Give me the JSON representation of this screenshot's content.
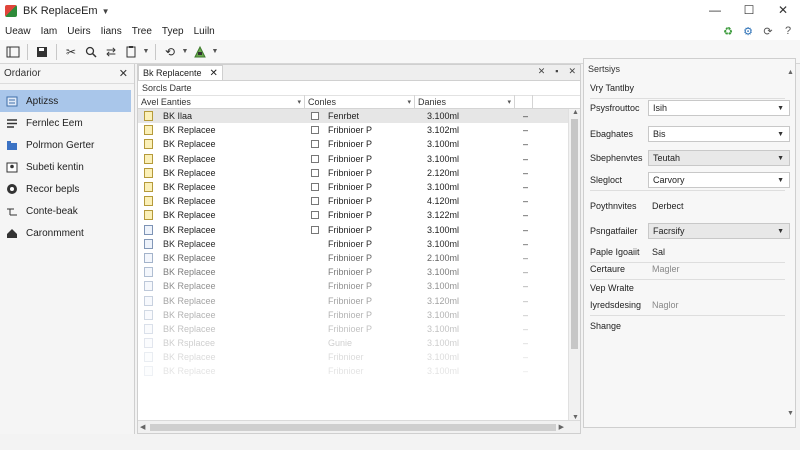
{
  "window": {
    "title": "BK ReplaceEm",
    "minimize": "—",
    "maximize": "☐",
    "close": "✕"
  },
  "menu": [
    "Ueaw",
    "Iam",
    "Ueirs",
    "Iians",
    "Tree",
    "Tyep",
    "Luiln"
  ],
  "toolbar": {
    "buttons": [
      "sidebar-icon",
      "save-icon",
      "cut-icon",
      "search-icon",
      "swap-icon",
      "paste-icon",
      "replace-icon",
      "run-icon"
    ]
  },
  "left_panel": {
    "title": "Ordarior",
    "close": "✕",
    "items": [
      {
        "label": "Aptizss",
        "icon": "list-icon",
        "active": true
      },
      {
        "label": "Fernlec Eem",
        "icon": "text-icon",
        "active": false
      },
      {
        "label": "Polrmon Gerter",
        "icon": "folder-icon",
        "active": false
      },
      {
        "label": "Subeti kentin",
        "icon": "contact-icon",
        "active": false
      },
      {
        "label": "Recor bepls",
        "icon": "record-icon",
        "active": false
      },
      {
        "label": "Conte-beak",
        "icon": "branch-icon",
        "active": false
      },
      {
        "label": "Caronmment",
        "icon": "home-icon",
        "active": false
      }
    ]
  },
  "document": {
    "tab_label": "Bk Replacente",
    "tab_close": "✕",
    "tab_tools": [
      "✕",
      "▪",
      "✕"
    ],
    "subtitle": "Sorcls Darte",
    "columns": [
      {
        "label": "Avel Eanties",
        "width": 167
      },
      {
        "label": "Conles",
        "width": 110
      },
      {
        "label": "Danies",
        "width": 100
      },
      {
        "label": "",
        "width": 18
      }
    ],
    "rows": [
      {
        "name": "BK Ilaa",
        "check": "Fenrbet",
        "size": "3.100ml",
        "dash": "–",
        "selected": true,
        "icon": "yellow",
        "opacity": 1
      },
      {
        "name": "BK Replacee",
        "check": "Fribnioer P",
        "size": "3.102ml",
        "dash": "–",
        "selected": false,
        "icon": "yellow",
        "opacity": 1
      },
      {
        "name": "BK Replacee",
        "check": "Fribnioer P",
        "size": "3.100ml",
        "dash": "–",
        "selected": false,
        "icon": "yellow",
        "opacity": 1
      },
      {
        "name": "BK Replacee",
        "check": "Fribnioer P",
        "size": "3.100ml",
        "dash": "–",
        "selected": false,
        "icon": "yellow",
        "opacity": 1
      },
      {
        "name": "BK Replacee",
        "check": "Fribnioer P",
        "size": "2.120ml",
        "dash": "–",
        "selected": false,
        "icon": "yellow",
        "opacity": 1
      },
      {
        "name": "BK Replacee",
        "check": "Fribnioer P",
        "size": "3.100ml",
        "dash": "–",
        "selected": false,
        "icon": "yellow",
        "opacity": 1
      },
      {
        "name": "BK Replacee",
        "check": "Fribnioer P",
        "size": "4.120ml",
        "dash": "–",
        "selected": false,
        "icon": "yellow",
        "opacity": 1
      },
      {
        "name": "BK Replacee",
        "check": "Fribnioer P",
        "size": "3.122ml",
        "dash": "–",
        "selected": false,
        "icon": "yellow",
        "opacity": 1
      },
      {
        "name": "BK Replacee",
        "check": "Fribnioer P",
        "size": "3.100ml",
        "dash": "–",
        "selected": false,
        "icon": "blue",
        "opacity": 1
      },
      {
        "name": "BK Replacee",
        "check": "Fribnioer P",
        "size": "3.100ml",
        "dash": "–",
        "selected": false,
        "icon": "blue",
        "opacity": 0.95
      },
      {
        "name": "BK Replacee",
        "check": "Fribnioer P",
        "size": "2.100ml",
        "dash": "–",
        "selected": false,
        "icon": "blue",
        "opacity": 0.7
      },
      {
        "name": "BK Replacee",
        "check": "Fribnioer P",
        "size": "3.100ml",
        "dash": "–",
        "selected": false,
        "icon": "blue",
        "opacity": 0.6
      },
      {
        "name": "BK Replacee",
        "check": "Fribnioer P",
        "size": "3.100ml",
        "dash": "–",
        "selected": false,
        "icon": "blue",
        "opacity": 0.5
      },
      {
        "name": "BK Replacee",
        "check": "Fribnioer P",
        "size": "3.120ml",
        "dash": "–",
        "selected": false,
        "icon": "blue",
        "opacity": 0.42
      },
      {
        "name": "BK Replacee",
        "check": "Fribnioer P",
        "size": "3.100ml",
        "dash": "–",
        "selected": false,
        "icon": "blue",
        "opacity": 0.35
      },
      {
        "name": "BK Replacee",
        "check": "Fribnioer P",
        "size": "3.100ml",
        "dash": "–",
        "selected": false,
        "icon": "blue",
        "opacity": 0.28
      },
      {
        "name": "BK Rsplacee",
        "check": "Gunie",
        "size": "3.100ml",
        "dash": "–",
        "selected": false,
        "icon": "blue",
        "opacity": 0.22
      },
      {
        "name": "BK Replacee",
        "check": "Fribnioer",
        "size": "3.100ml",
        "dash": "–",
        "selected": false,
        "icon": "blue",
        "opacity": 0.16
      },
      {
        "name": "BK Replacee",
        "check": "Fribnioer",
        "size": "3.100ml",
        "dash": "–",
        "selected": false,
        "icon": "blue",
        "opacity": 0.12
      }
    ]
  },
  "properties": {
    "title": "Sertsiys",
    "items": [
      {
        "label": "Vry Tantlby",
        "value": "",
        "style": "plain",
        "caret": false
      },
      {
        "label": "Psysfrouttoc",
        "value": "Isih",
        "style": "boxed",
        "caret": true
      },
      {
        "label": "Ebaghates",
        "value": "Bis",
        "style": "boxed",
        "caret": true
      },
      {
        "label": "Sbephenvtes",
        "value": "Teutah",
        "style": "shaded",
        "caret": true
      },
      {
        "label": "Slegloct",
        "value": "Carvory",
        "style": "boxed",
        "caret": true
      },
      {
        "label": "Poythnvites",
        "value": "Derbect",
        "style": "plain",
        "caret": false
      },
      {
        "label": "Psngatfailer",
        "value": "Facrsify",
        "style": "shaded",
        "caret": true
      },
      {
        "label": "Paple Igoaiit",
        "value": "Sal",
        "style": "plain",
        "caret": false
      },
      {
        "label": "Certaure",
        "value": "Magler",
        "style": "muted",
        "caret": false
      },
      {
        "label": "Vep Wralte",
        "value": "",
        "style": "plain",
        "caret": false
      },
      {
        "label": "Iyredsdesing",
        "value": "Naglor",
        "style": "muted",
        "caret": false
      },
      {
        "label": "Shange",
        "value": "",
        "style": "plain",
        "caret": false
      }
    ]
  }
}
